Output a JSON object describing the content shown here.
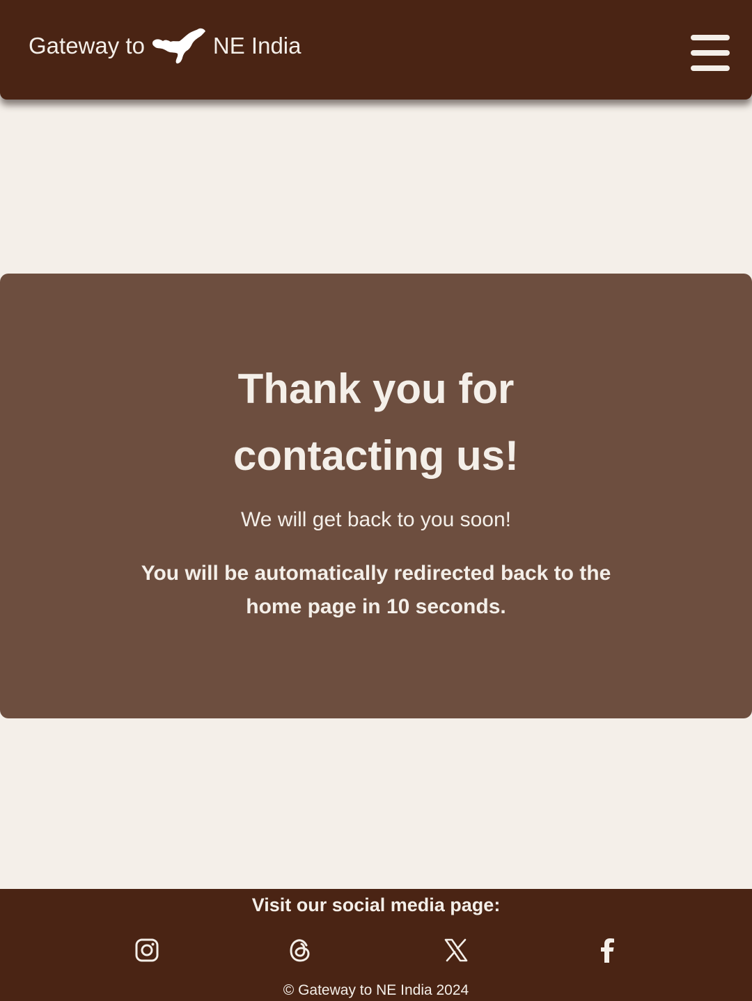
{
  "header": {
    "brand_prefix": "Gateway to",
    "brand_suffix": "NE India",
    "logo_icon": "assam-map-icon",
    "menu_icon": "hamburger-menu-icon"
  },
  "message": {
    "title": "Thank you for contacting us!",
    "subtitle": "We will get back to you soon!",
    "redirect_notice": "You will be automatically redirected back to the home page in 10 seconds."
  },
  "footer": {
    "follow_text": "Visit our social media page:",
    "social_icons": [
      "instagram-icon",
      "threads-icon",
      "x-icon",
      "facebook-icon"
    ],
    "copyright": "© Gateway to NE India 2024"
  },
  "colors": {
    "header_bg": "#4a2414",
    "page_bg": "#f4efe9",
    "card_bg": "#6d4e3f",
    "text_light": "#f4efe9"
  }
}
